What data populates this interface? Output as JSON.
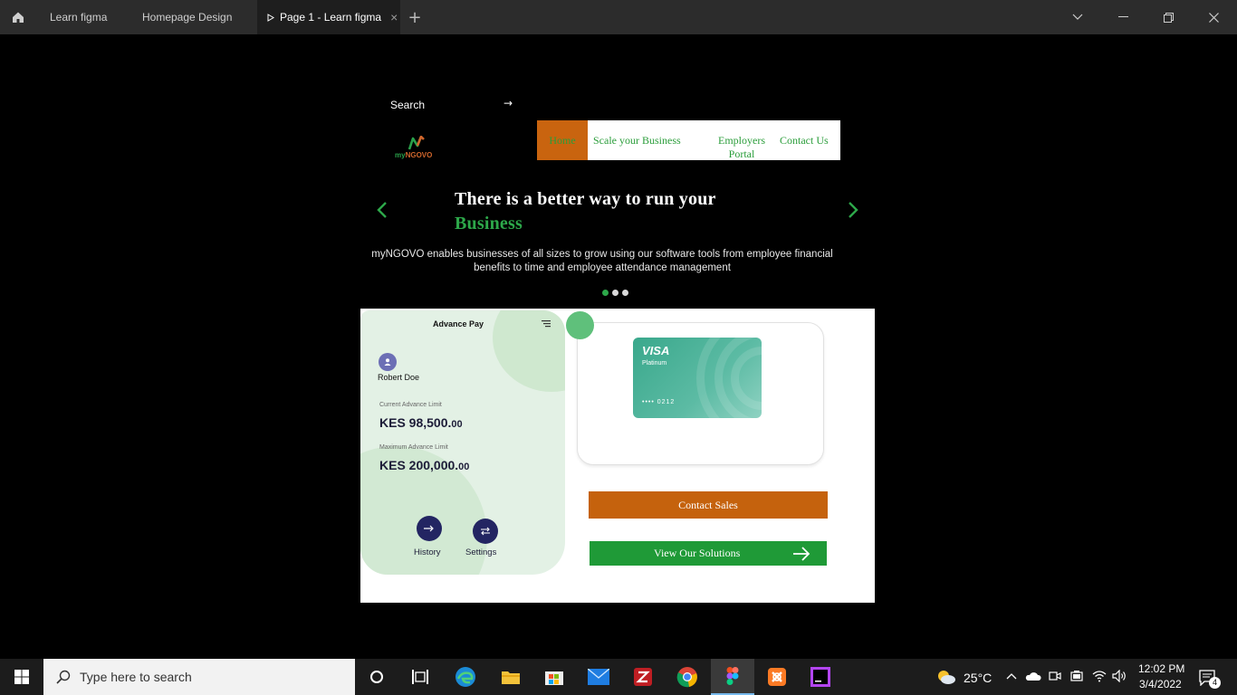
{
  "titlebar": {
    "tabs": [
      {
        "label": "Learn figma"
      },
      {
        "label": "Homepage Design"
      },
      {
        "label": "Page 1 - Learn figma",
        "close": "×"
      }
    ],
    "new_tab": "+"
  },
  "site": {
    "search_label": "Search",
    "search_arrow": "→",
    "logo": {
      "my": "my",
      "ngovo": "NGOVO"
    },
    "nav": [
      {
        "label": "Home"
      },
      {
        "label": "Scale your Business"
      },
      {
        "label": "Employers Portal"
      },
      {
        "label": "Contact Us"
      }
    ],
    "headline_line1": "There is a better way to run your",
    "headline_accent": "Business",
    "subtext": "myNGOVO enables businesses of all sizes to grow using our software tools from employee financial benefits to time and employee attendance management",
    "carousel_dots": 3,
    "active_dot": 0,
    "colors": {
      "brand_green": "#2da84a",
      "brand_orange": "#c5620d"
    }
  },
  "phone": {
    "title": "Advance Pay",
    "user_name": "Robert Doe",
    "current_label": "Current Advance Limit",
    "current_amount": "KES 98,500.",
    "current_cents": "00",
    "max_label": "Maximum Advance Limit",
    "max_amount": "KES 200,000.",
    "max_cents": "00",
    "history_label": "History",
    "settings_label": "Settings"
  },
  "card": {
    "brand": "VISA",
    "tier": "Platinum",
    "number": "•••• 0212"
  },
  "cta": {
    "contact_sales": "Contact Sales",
    "view_solutions": "View Our Solutions"
  },
  "taskbar": {
    "search_placeholder": "Type here to search",
    "temperature": "25°C",
    "time": "12:02 PM",
    "date": "3/4/2022",
    "notifications": "4"
  }
}
